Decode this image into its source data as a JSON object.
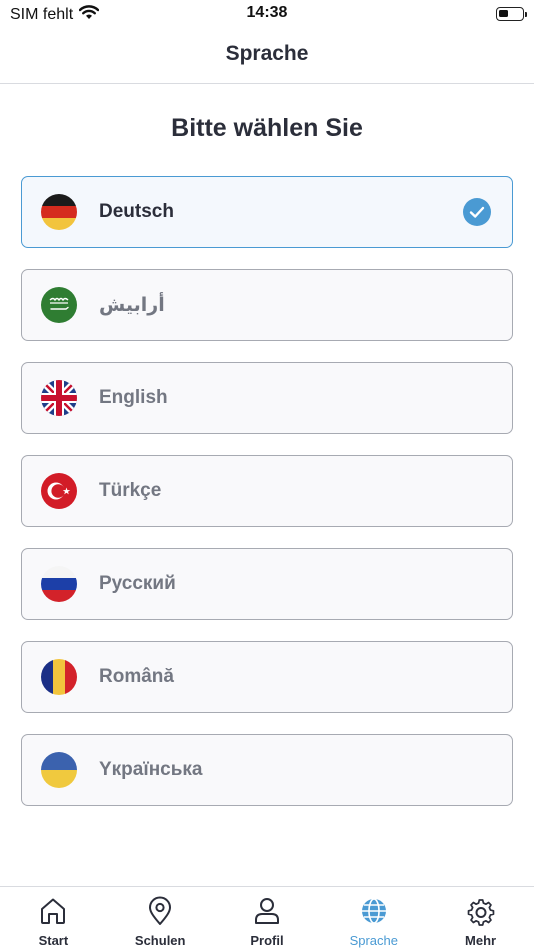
{
  "status": {
    "carrier": "SIM fehlt",
    "time": "14:38",
    "battery_level": 0.45
  },
  "nav": {
    "title": "Sprache"
  },
  "heading": "Bitte wählen Sie",
  "languages": [
    {
      "label": "Deutsch",
      "flag": "germany-flag-icon",
      "selected": true
    },
    {
      "label": "أرابيش",
      "flag": "saudi-arabia-flag-icon",
      "selected": false
    },
    {
      "label": "English",
      "flag": "uk-flag-icon",
      "selected": false
    },
    {
      "label": "Türkçe",
      "flag": "turkey-flag-icon",
      "selected": false
    },
    {
      "label": "Русский",
      "flag": "russia-flag-icon",
      "selected": false
    },
    {
      "label": "Română",
      "flag": "romania-flag-icon",
      "selected": false
    },
    {
      "label": "Yкраїнська",
      "flag": "ukraine-flag-icon",
      "selected": false
    }
  ],
  "tabs": [
    {
      "label": "Start",
      "icon": "home-icon",
      "active": false
    },
    {
      "label": "Schulen",
      "icon": "location-pin-icon",
      "active": false
    },
    {
      "label": "Profil",
      "icon": "user-icon",
      "active": false
    },
    {
      "label": "Sprache",
      "icon": "globe-icon",
      "active": true
    },
    {
      "label": "Mehr",
      "icon": "gear-icon",
      "active": false
    }
  ],
  "colors": {
    "accent": "#4a9ad3",
    "text": "#2b2e3a",
    "muted_text": "#737782",
    "border": "#a7aab2"
  }
}
